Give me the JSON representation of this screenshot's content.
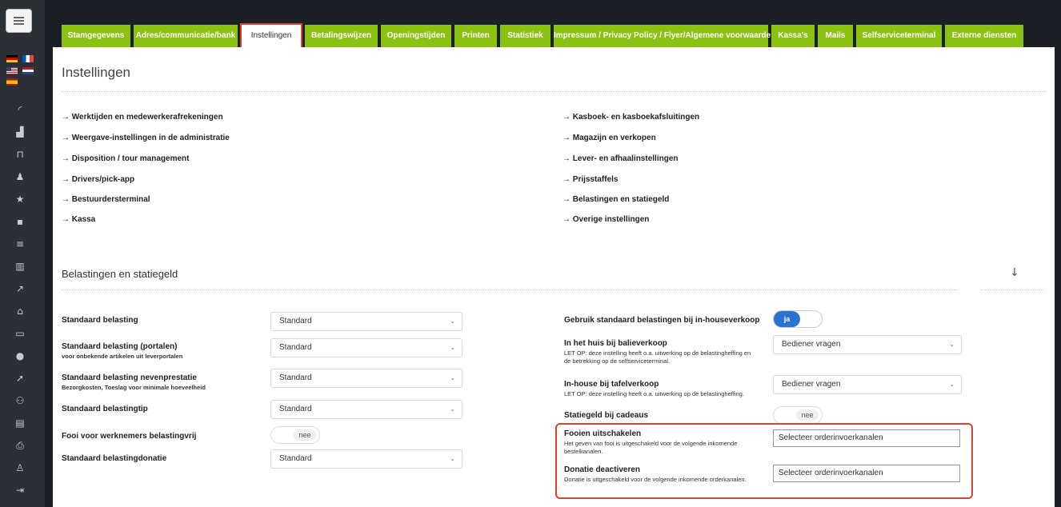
{
  "tabs": [
    {
      "label": "Stamgegevens"
    },
    {
      "label": "Adres/communicatie/bank"
    },
    {
      "label": "Instellingen"
    },
    {
      "label": "Betalingswijzen"
    },
    {
      "label": "Openingstijden"
    },
    {
      "label": "Printen"
    },
    {
      "label": "Statistiek"
    },
    {
      "label": "Impressum / Privacy Policy / Flyer/Algemene voorwaarden"
    },
    {
      "label": "Kassa's"
    },
    {
      "label": "Mails"
    },
    {
      "label": "Selfserviceterminal"
    },
    {
      "label": "Externe diensten"
    }
  ],
  "page_title": "Instellingen",
  "links_left": [
    "→ Werktijden en medewerkerafrekeningen",
    "→ Weergave-instellingen in de administratie",
    "→ Disposition / tour management",
    "→ Drivers/pick-app",
    "→ Bestuurdersterminal",
    "→ Kassa"
  ],
  "links_right": [
    "→ Kasboek- en kasboekafsluitingen",
    "→ Magazijn en verkopen",
    "→ Lever- en afhaalinstellingen",
    "→ Prijsstaffels",
    "→ Belastingen en statiegeld",
    "→ Overige instellingen"
  ],
  "section_title": "Belastingen en statiegeld",
  "down_arrow": "↓",
  "left_fields": {
    "std_tax": {
      "label": "Standaard belasting",
      "value": "Standard"
    },
    "std_tax_portals": {
      "label": "Standaard belasting (portalen)",
      "sub": "voor onbekende artikelen uit leverportalen",
      "value": "Standard"
    },
    "std_tax_side": {
      "label": "Standaard belasting nevenprestatie",
      "sub": "Bezorgkosten, Toeslag voor minimale hoeveelheid",
      "value": "Standard"
    },
    "std_tax_tip": {
      "label": "Standaard belastingtip",
      "value": "Standard"
    },
    "tip_taxfree": {
      "label": "Fooi voor werknemers belastingvrij",
      "toggle": "nee"
    },
    "std_tax_donation": {
      "label": "Standaard belastingdonatie",
      "value": "Standard"
    }
  },
  "right_fields": {
    "use_std_inhouse": {
      "label": "Gebruik standaard belastingen bij in-houseverkoop",
      "toggle": "ja"
    },
    "counter_sale": {
      "label": "In het huis bij balieverkoop",
      "sub": "LET OP: deze instelling heeft o.a. uitwerking op de belastingheffing en de betrekking op de selfserviceterminal.",
      "value": "Bediener vragen"
    },
    "table_sale": {
      "label": "In-house bij tafelverkoop",
      "sub": "LET OP: deze instelling heeft o.a. uitwerking op de belastingheffing.",
      "value": "Bediener vragen"
    },
    "deposit_gifts": {
      "label": "Statiegeld bij cadeaus",
      "toggle": "nee"
    },
    "disable_tips": {
      "label": "Fooien uitschakelen",
      "sub": "Het geven van fooi is uitgeschakeld voor de volgende inkomende bestelkanalen.",
      "value": "Selecteer orderinvoerkanalen"
    },
    "disable_donation": {
      "label": "Donatie deactiveren",
      "sub": "Donatie is uitgeschakeld voor de volgende inkomende orderkanalen.",
      "value": "Selecteer orderinvoerkanalen"
    }
  },
  "chevron": "⌄"
}
